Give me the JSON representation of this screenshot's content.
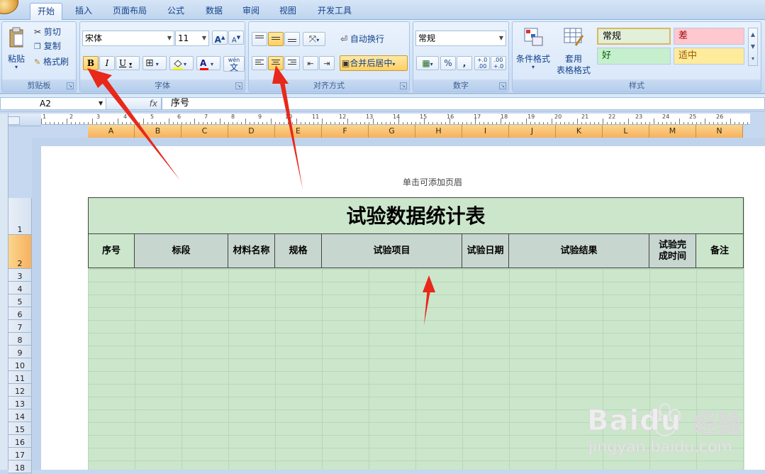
{
  "tabs": [
    "开始",
    "插入",
    "页面布局",
    "公式",
    "数据",
    "审阅",
    "视图",
    "开发工具"
  ],
  "clipboard": {
    "paste": "粘贴",
    "cut": "剪切",
    "copy": "复制",
    "format_painter": "格式刷",
    "caption": "剪贴板"
  },
  "font": {
    "name": "宋体",
    "size": "11",
    "grow": "A",
    "shrink": "A",
    "bold": "B",
    "italic": "I",
    "underline": "U",
    "fill_color": "#ffff00",
    "font_color": "#ff0000",
    "phonetic": "wén",
    "phonetic_char": "文",
    "caption": "字体"
  },
  "alignment": {
    "wrap": "自动换行",
    "merge": "合并后居中",
    "caption": "对齐方式"
  },
  "number": {
    "format": "常规",
    "percent": "%",
    "comma": ",",
    "inc": "+.0 .00",
    "dec": ".00 +.0",
    "caption": "数字"
  },
  "styles": {
    "cond_format": "条件格式",
    "table_format_1": "套用",
    "table_format_2": "表格格式",
    "normal": "常规",
    "bad": "差",
    "good": "好",
    "neutral": "适中",
    "caption": "样式"
  },
  "formula_bar": {
    "name_box": "A2",
    "fx": "fx",
    "value": "序号"
  },
  "columns": [
    "A",
    "B",
    "C",
    "D",
    "E",
    "F",
    "G",
    "H",
    "I",
    "J",
    "K",
    "L",
    "M",
    "N"
  ],
  "rows": [
    "1",
    "2",
    "3",
    "4",
    "5",
    "6",
    "7",
    "8",
    "9",
    "10",
    "11",
    "12",
    "13",
    "14",
    "15",
    "16",
    "17",
    "18"
  ],
  "ruler_numbers": [
    "1",
    "2",
    "3",
    "4",
    "5",
    "6",
    "7",
    "8",
    "9",
    "10",
    "11",
    "12",
    "13",
    "14",
    "15",
    "16",
    "17",
    "18",
    "19",
    "20",
    "21",
    "22",
    "23",
    "24",
    "25",
    "26"
  ],
  "page": {
    "header_hint": "单击可添加页眉"
  },
  "sheet": {
    "title": "试验数据统计表",
    "headers": [
      "序号",
      "标段",
      "材料名称",
      "规格",
      "试验项目",
      "试验日期",
      "试验结果",
      "试验完\n成时间",
      "备注"
    ]
  },
  "watermark": {
    "brand": "Baidu",
    "brand_cn": "经验",
    "url": "jingyan.baidu.com"
  }
}
